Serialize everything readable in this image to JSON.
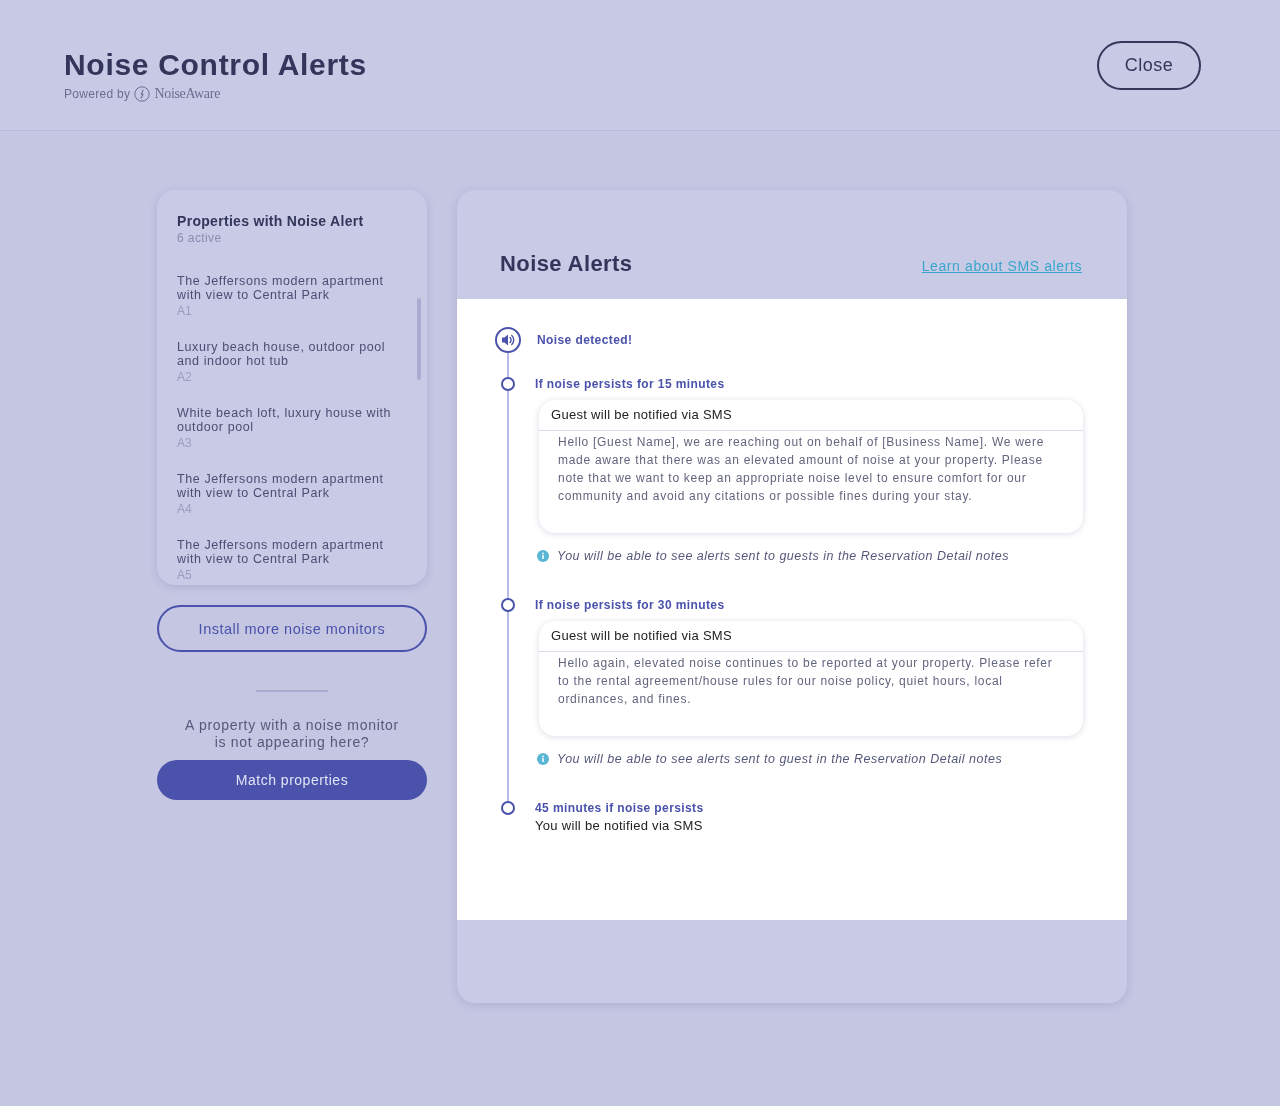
{
  "header": {
    "title": "Noise Control Alerts",
    "powered_by": "Powered by",
    "brand": "NoiseAware",
    "close_button": "Close"
  },
  "properties_panel": {
    "title": "Properties with Noise Alert",
    "count": "6 active",
    "items": [
      {
        "name": "The Jeffersons modern apartment with view to Central Park",
        "code": "A1"
      },
      {
        "name": "Luxury beach house, outdoor pool and indoor hot tub",
        "code": "A2"
      },
      {
        "name": "White beach loft, luxury house with outdoor pool",
        "code": "A3"
      },
      {
        "name": "The Jeffersons modern apartment with view to Central Park",
        "code": "A4"
      },
      {
        "name": "The Jeffersons modern apartment with view to Central Park",
        "code": "A5"
      }
    ]
  },
  "install_button": "Install more noise monitors",
  "missing_prompt": "A property with a noise monitor is not appearing here?",
  "match_button": "Match properties",
  "alerts": {
    "title": "Noise Alerts",
    "link": "Learn about SMS alerts",
    "steps": [
      {
        "kind": "detected",
        "label": "Noise detected!"
      },
      {
        "kind": "message",
        "label": "If noise persists for 15 minutes",
        "card_title": "Guest will be notified via SMS",
        "message": "Hello [Guest Name], we are reaching out on behalf of [Business Name]. We were made aware that there was an elevated amount of noise at your property. Please note that we want to keep an appropriate noise level to ensure comfort for our community and avoid any citations or possible fines during your stay.",
        "note": "You will be able to see alerts sent to guests in the Reservation Detail notes"
      },
      {
        "kind": "message",
        "label": "If noise persists for 30 minutes",
        "card_title": "Guest will be notified via SMS",
        "message": "Hello again, elevated noise continues to be reported at your property. Please refer to the rental agreement/house rules for our noise policy, quiet hours, local ordinances, and fines.",
        "note": "You will be able to see alerts sent to guest in the Reservation Detail notes"
      },
      {
        "kind": "notify",
        "label": "45 minutes if noise persists",
        "detail": "You will be notified via SMS"
      }
    ]
  }
}
